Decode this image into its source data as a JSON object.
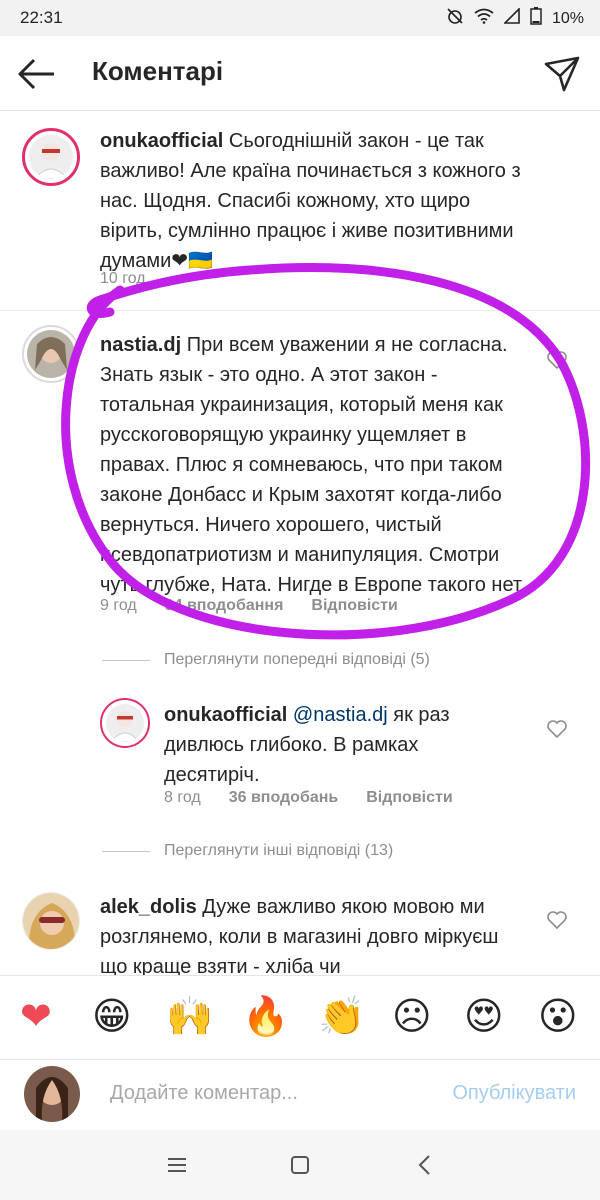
{
  "status_bar": {
    "time": "22:31",
    "battery": "10%"
  },
  "header": {
    "title": "Коментарі"
  },
  "comments": [
    {
      "user": "onukaofficial",
      "text": "Сьогоднішній закон - це так важливо! Але країна починається з кожного з нас. Щодня. Спасибі кожному, хто щиро вірить, сумлінно працює і живе позитивними думами❤🇺🇦",
      "time": "10 год"
    },
    {
      "user": "nastia.dj",
      "text": "При всем уважении я не согласна. Знать язык - это одно. А этот закон - тотальная украинизация, который меня как русскоговорящую украинку ущемляет в правах. Плюс я сомневаюсь, что при таком законе Донбасс и Крым захотят когда-либо вернуться. Ничего хорошего, чистый псевдопатриотизм и манипуляция. Смотри чуть глубже, Ната. Нигде в Европе такого нет.",
      "time": "9 год",
      "likes": "34 вподобання",
      "reply": "Відповісти",
      "view_previous": "Переглянути попередні відповіді (5)"
    },
    {
      "user": "onukaofficial",
      "mention": "@nastia.dj",
      "text": " як раз дивлюсь глибоко. В рамках десятиріч.",
      "time": "8 год",
      "likes": "36 вподобань",
      "reply": "Відповісти",
      "view_other": "Переглянути інші відповіді (13)"
    },
    {
      "user": "alek_dolis",
      "text": "Дуже важливо якою мовою ми розглянемо, коли в магазині довго міркуєш що краще взяти - хліба чи",
      "time": ""
    }
  ],
  "emoji_bar": [
    "❤",
    "😁",
    "🙌",
    "🔥",
    "👏",
    "☹",
    "😍",
    "😮"
  ],
  "input": {
    "placeholder": "Додайте коментар...",
    "post_label": "Опублікувати"
  },
  "colors": {
    "accent": "#3897f0",
    "annotation": "#c020e8",
    "heart": "#ed4956"
  }
}
